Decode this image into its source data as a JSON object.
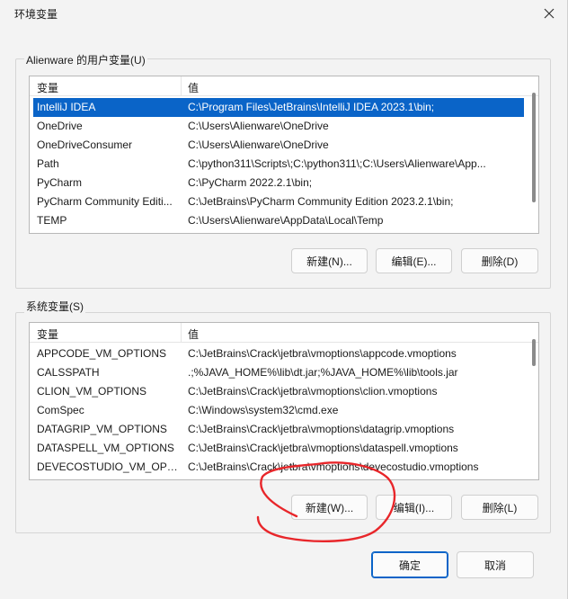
{
  "window": {
    "title": "环境变量"
  },
  "user_vars": {
    "group_label": "Alienware 的用户变量(U)",
    "columns": {
      "name": "变量",
      "value": "值"
    },
    "rows": [
      {
        "name": "IntelliJ IDEA",
        "value": "C:\\Program Files\\JetBrains\\IntelliJ IDEA 2023.1\\bin;"
      },
      {
        "name": "OneDrive",
        "value": "C:\\Users\\Alienware\\OneDrive"
      },
      {
        "name": "OneDriveConsumer",
        "value": "C:\\Users\\Alienware\\OneDrive"
      },
      {
        "name": "Path",
        "value": "C:\\python311\\Scripts\\;C:\\python311\\;C:\\Users\\Alienware\\App..."
      },
      {
        "name": "PyCharm",
        "value": "C:\\PyCharm 2022.2.1\\bin;"
      },
      {
        "name": "PyCharm Community Editi...",
        "value": "C:\\JetBrains\\PyCharm Community Edition 2023.2.1\\bin;"
      },
      {
        "name": "TEMP",
        "value": "C:\\Users\\Alienware\\AppData\\Local\\Temp"
      }
    ],
    "buttons": {
      "new": "新建(N)...",
      "edit": "编辑(E)...",
      "delete": "删除(D)"
    }
  },
  "system_vars": {
    "group_label": "系统变量(S)",
    "columns": {
      "name": "变量",
      "value": "值"
    },
    "rows": [
      {
        "name": "APPCODE_VM_OPTIONS",
        "value": "C:\\JetBrains\\Crack\\jetbra\\vmoptions\\appcode.vmoptions"
      },
      {
        "name": "CALSSPATH",
        "value": ".;%JAVA_HOME%\\lib\\dt.jar;%JAVA_HOME%\\lib\\tools.jar"
      },
      {
        "name": "CLION_VM_OPTIONS",
        "value": "C:\\JetBrains\\Crack\\jetbra\\vmoptions\\clion.vmoptions"
      },
      {
        "name": "ComSpec",
        "value": "C:\\Windows\\system32\\cmd.exe"
      },
      {
        "name": "DATAGRIP_VM_OPTIONS",
        "value": "C:\\JetBrains\\Crack\\jetbra\\vmoptions\\datagrip.vmoptions"
      },
      {
        "name": "DATASPELL_VM_OPTIONS",
        "value": "C:\\JetBrains\\Crack\\jetbra\\vmoptions\\dataspell.vmoptions"
      },
      {
        "name": "DEVECOSTUDIO_VM_OPT...",
        "value": "C:\\JetBrains\\Crack\\jetbra\\vmoptions\\devecostudio.vmoptions"
      }
    ],
    "buttons": {
      "new": "新建(W)...",
      "edit": "编辑(I)...",
      "delete": "删除(L)"
    }
  },
  "footer": {
    "ok": "确定",
    "cancel": "取消"
  },
  "colors": {
    "selection": "#0a64c8",
    "annotation": "#e8262a"
  }
}
